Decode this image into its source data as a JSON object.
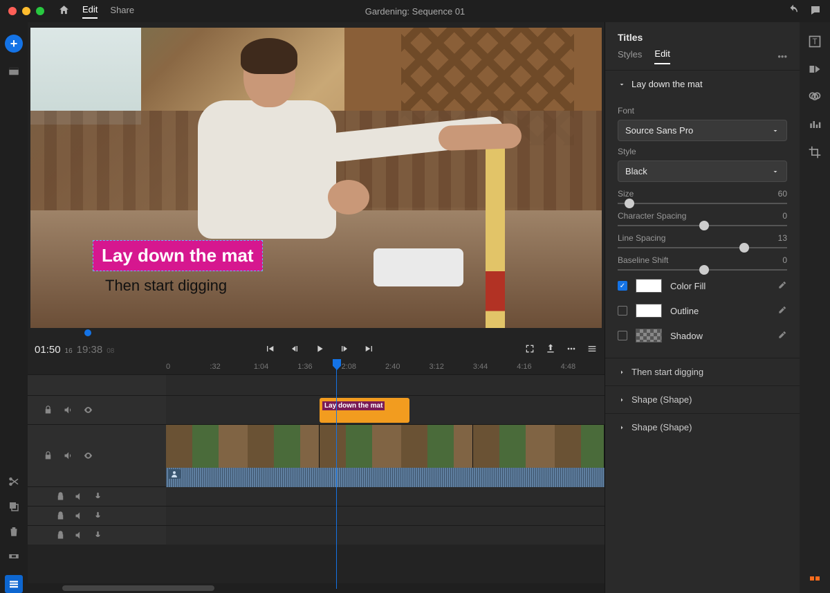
{
  "titlebar": {
    "project": "Gardening: Sequence 01",
    "tabs": {
      "edit": "Edit",
      "share": "Share"
    }
  },
  "preview": {
    "title_text": "Lay down the mat",
    "subtitle_text": "Then start digging"
  },
  "transport": {
    "current": "01:50",
    "current_frames": "16",
    "total": "19:38",
    "total_frames": "08"
  },
  "ruler": {
    "marks": [
      "0",
      ":32",
      "1:04",
      "1:36",
      "2:08",
      "2:40",
      "3:12",
      "3:44",
      "4:16",
      "4:48"
    ]
  },
  "timeline": {
    "title_clip": "Lay down the mat"
  },
  "right": {
    "panel_title": "Titles",
    "tabs": {
      "styles": "Styles",
      "edit": "Edit"
    },
    "section": "Lay down the mat",
    "font_label": "Font",
    "font_value": "Source Sans Pro",
    "style_label": "Style",
    "style_value": "Black",
    "size_label": "Size",
    "size_value": "60",
    "charspacing_label": "Character Spacing",
    "charspacing_value": "0",
    "linespacing_label": "Line Spacing",
    "linespacing_value": "13",
    "baseline_label": "Baseline Shift",
    "baseline_value": "0",
    "colorfill": "Color Fill",
    "outline": "Outline",
    "shadow": "Shadow",
    "sec2": "Then start digging",
    "sec3": "Shape (Shape)",
    "sec4": "Shape (Shape)"
  }
}
